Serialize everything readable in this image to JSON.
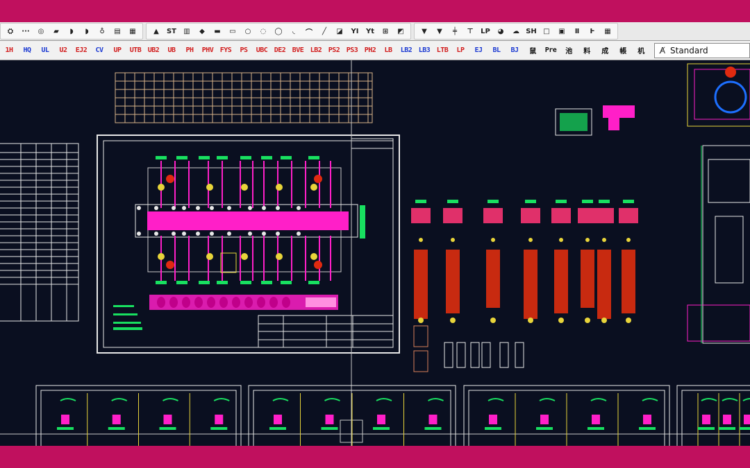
{
  "toolbar_row1": {
    "groups": [
      [
        {
          "icon": "layer-manager-icon",
          "label": "⛭"
        },
        {
          "icon": "dots-icon",
          "label": "···"
        },
        {
          "icon": "circle-refresh-icon",
          "label": "◎"
        },
        {
          "icon": "paint-icon",
          "label": "▰"
        },
        {
          "icon": "lips-icon",
          "label": "◗"
        },
        {
          "icon": "lips-icon",
          "label": "◗"
        },
        {
          "icon": "bulb-icon",
          "label": "♁"
        },
        {
          "icon": "folder-icon",
          "label": "▤"
        },
        {
          "icon": "grid-icon",
          "label": "▦"
        }
      ],
      [
        {
          "icon": "stack-icon",
          "label": "▲"
        },
        {
          "icon": "text-st-icon",
          "label": "ST"
        },
        {
          "icon": "hatch-icon",
          "label": "▥"
        },
        {
          "icon": "cube-icon",
          "label": "◆"
        },
        {
          "icon": "block-icon",
          "label": "▬"
        },
        {
          "icon": "square-icon",
          "label": "▭"
        },
        {
          "icon": "circle-icon",
          "label": "○"
        },
        {
          "icon": "donut-icon",
          "label": "◌"
        },
        {
          "icon": "ring-icon",
          "label": "◯"
        },
        {
          "icon": "arc-icon",
          "label": "◟"
        },
        {
          "icon": "curve-icon",
          "label": "⌒"
        },
        {
          "icon": "line-icon",
          "label": "╱"
        },
        {
          "icon": "shape-icon",
          "label": "◪"
        },
        {
          "icon": "text-yi-icon",
          "label": "YI"
        },
        {
          "icon": "text-yt-icon",
          "label": "Yt"
        },
        {
          "icon": "ruler-icon",
          "label": "⊞"
        },
        {
          "icon": "measure-icon",
          "label": "◩"
        }
      ],
      [
        {
          "icon": "pin-icon",
          "label": "▼"
        },
        {
          "icon": "pin-icon",
          "label": "▼"
        },
        {
          "icon": "align-icon",
          "label": "╪"
        },
        {
          "icon": "trim-icon",
          "label": "⊤"
        },
        {
          "icon": "lp-icon",
          "label": "LP"
        },
        {
          "icon": "globe-icon",
          "label": "◕"
        },
        {
          "icon": "cloud-icon",
          "label": "☁"
        },
        {
          "icon": "sh-icon",
          "label": "SH"
        },
        {
          "icon": "rect-icon",
          "label": "□"
        },
        {
          "icon": "calc-icon",
          "label": "▣"
        },
        {
          "icon": "pillar-icon",
          "label": "Ⅱ"
        },
        {
          "icon": "text-wang-icon",
          "label": "Ⱶ"
        },
        {
          "icon": "table-icon",
          "label": "▦"
        }
      ]
    ]
  },
  "toolbar_row2": {
    "buttons": [
      {
        "label": "1H",
        "color": "red"
      },
      {
        "label": "HQ",
        "color": "blue"
      },
      {
        "label": "UL",
        "color": "blue"
      },
      {
        "label": "U2",
        "color": "red"
      },
      {
        "label": "EJ2",
        "color": "red"
      },
      {
        "label": "CV",
        "color": "blue"
      },
      {
        "label": "UP",
        "color": "red"
      },
      {
        "label": "UTB",
        "color": "red"
      },
      {
        "label": "UB2",
        "color": "red"
      },
      {
        "label": "UB",
        "color": "red"
      },
      {
        "label": "PH",
        "color": "red"
      },
      {
        "label": "PHV",
        "color": "red"
      },
      {
        "label": "FYS",
        "color": "red"
      },
      {
        "label": "PS",
        "color": "red"
      },
      {
        "label": "UBC",
        "color": "red"
      },
      {
        "label": "DE2",
        "color": "red"
      },
      {
        "label": "BVE",
        "color": "red"
      },
      {
        "label": "LB2",
        "color": "red"
      },
      {
        "label": "PS2",
        "color": "red"
      },
      {
        "label": "PS3",
        "color": "red"
      },
      {
        "label": "PH2",
        "color": "red"
      },
      {
        "label": "LB",
        "color": "red"
      },
      {
        "label": "LB2",
        "color": "blue"
      },
      {
        "label": "LB3",
        "color": "blue"
      },
      {
        "label": "LTB",
        "color": "red"
      },
      {
        "label": "LP",
        "color": "red"
      },
      {
        "label": "EJ",
        "color": "blue"
      },
      {
        "label": "BL",
        "color": "blue"
      },
      {
        "label": "BJ",
        "color": "blue"
      },
      {
        "label": "鼠",
        "color": "black"
      },
      {
        "label": "Pre",
        "color": "black"
      },
      {
        "label": "池",
        "color": "black"
      },
      {
        "label": "料",
        "color": "black"
      },
      {
        "label": "成",
        "color": "black"
      },
      {
        "label": "帳",
        "color": "black"
      },
      {
        "label": "机",
        "color": "black"
      }
    ],
    "style_name": "Standard",
    "style_icon": "text-style-icon"
  },
  "colors": {
    "frame": "#c0105e",
    "canvas": "#0a0f20",
    "magenta": "#ff1fc8",
    "green": "#18e060",
    "red": "#e02a10",
    "yellow": "#e8d43a",
    "white": "#e8e8e8",
    "tan": "#d9b48a"
  }
}
